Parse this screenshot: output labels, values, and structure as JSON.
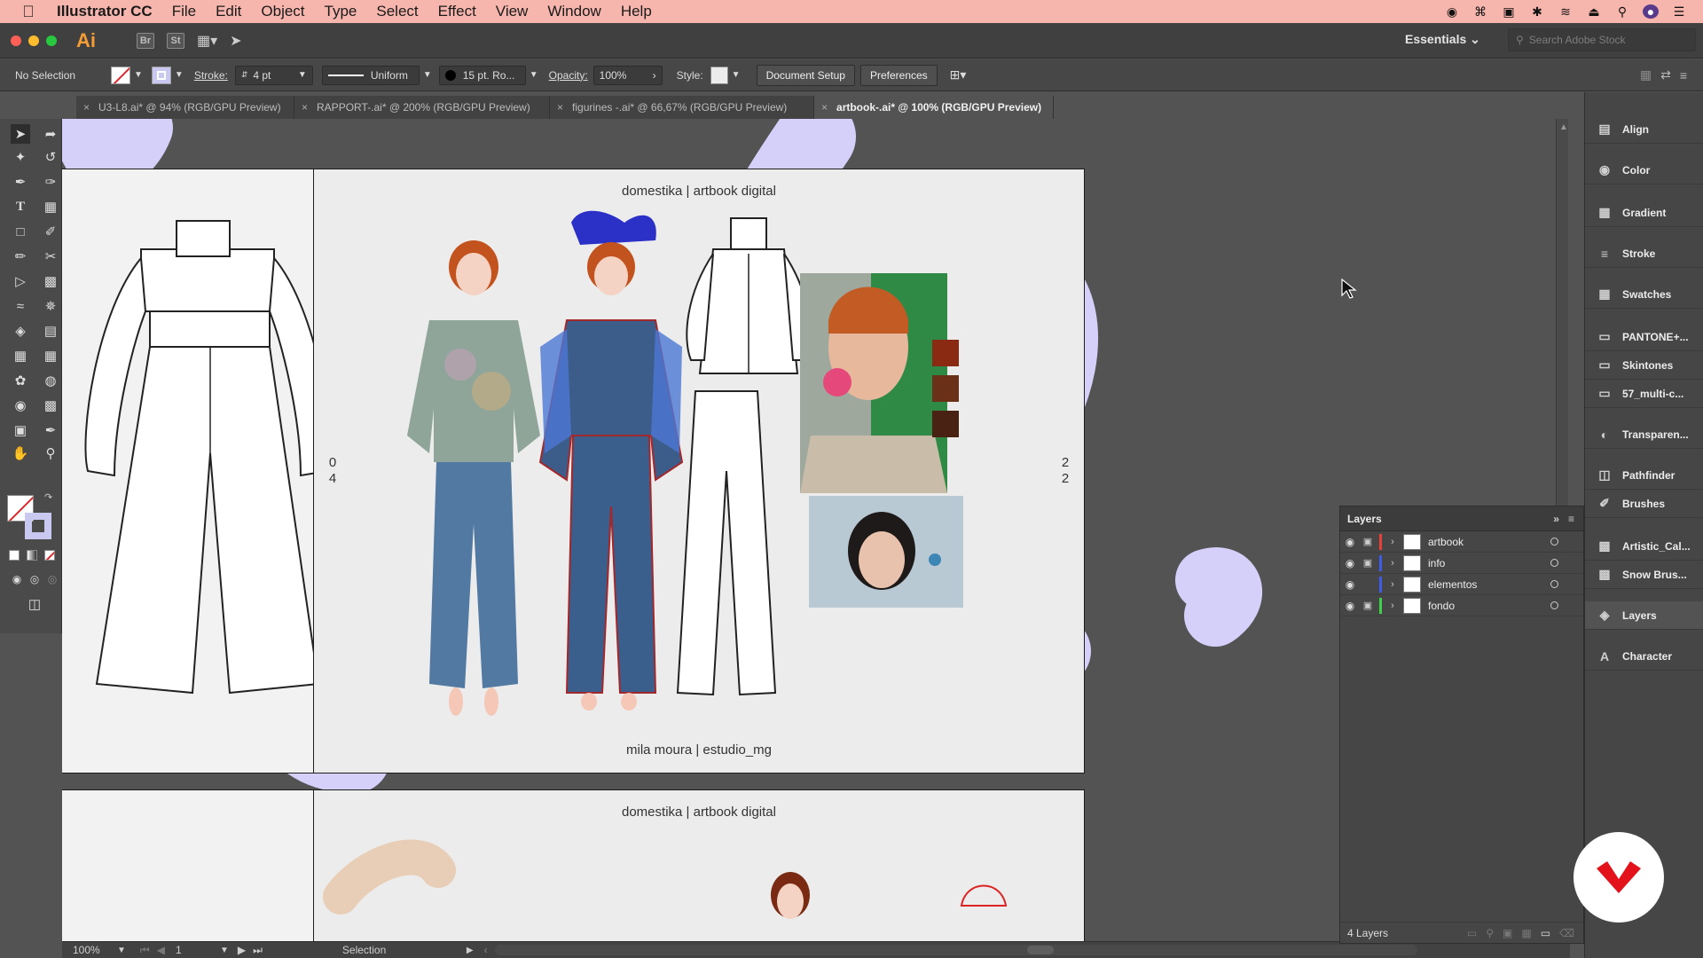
{
  "menubar": {
    "app_name": "Illustrator CC",
    "items": [
      "File",
      "Edit",
      "Object",
      "Type",
      "Select",
      "Effect",
      "View",
      "Window",
      "Help"
    ]
  },
  "appbar": {
    "logo": "Ai",
    "bridge": "Br",
    "stock": "St",
    "workspace": "Essentials",
    "search_placeholder": "Search Adobe Stock"
  },
  "control": {
    "selection": "No Selection",
    "stroke_label": "Stroke:",
    "stroke_weight": "4 pt",
    "profile": "Uniform",
    "brush": "15 pt. Ro...",
    "opacity_label": "Opacity:",
    "opacity": "100%",
    "style_label": "Style:",
    "doc_setup": "Document Setup",
    "preferences": "Preferences"
  },
  "tabs": [
    {
      "label": "U3-L8.ai* @ 94% (RGB/GPU Preview)",
      "active": false
    },
    {
      "label": "RAPPORT-.ai* @ 200% (RGB/GPU Preview)",
      "active": false
    },
    {
      "label": "figurines -.ai* @ 66,67% (RGB/GPU Preview)",
      "active": false
    },
    {
      "label": "artbook-.ai* @ 100% (RGB/GPU Preview)",
      "active": true
    }
  ],
  "artboard": {
    "header": "domestika | artbook digital",
    "footer": "mila moura | estudio_mg",
    "header2": "domestika | artbook digital",
    "left_page_num": [
      "2",
      "2"
    ],
    "mid_page_num": [
      "0",
      "4"
    ],
    "right_page_num": [
      "2",
      "2"
    ]
  },
  "palette_colors": [
    "#8a2a12",
    "#6a3118",
    "#4a2214"
  ],
  "accent_lavender": "#d4d0fa",
  "status": {
    "zoom": "100%",
    "page": "1",
    "mode": "Selection"
  },
  "dock": [
    {
      "label": "Align",
      "icon": "align-icon"
    },
    {
      "label": "Color",
      "icon": "color-icon"
    },
    {
      "label": "Gradient",
      "icon": "gradient-icon"
    },
    {
      "label": "Stroke",
      "icon": "stroke-icon"
    },
    {
      "label": "Swatches",
      "icon": "swatches-icon"
    },
    {
      "label": "PANTONE+...",
      "icon": "folder-icon"
    },
    {
      "label": "Skintones",
      "icon": "folder-icon"
    },
    {
      "label": "57_multi-c...",
      "icon": "folder-icon"
    },
    {
      "label": "Transparen...",
      "icon": "transparency-icon"
    },
    {
      "label": "Pathfinder",
      "icon": "pathfinder-icon"
    },
    {
      "label": "Brushes",
      "icon": "brushes-icon"
    },
    {
      "label": "Artistic_Cal...",
      "icon": "brush-library-icon"
    },
    {
      "label": "Snow Brus...",
      "icon": "brush-library-icon"
    },
    {
      "label": "Layers",
      "icon": "layers-icon"
    },
    {
      "label": "Character",
      "icon": "character-icon"
    }
  ],
  "layers": {
    "title": "Layers",
    "rows": [
      {
        "name": "artbook",
        "color": "#e8413c",
        "locked": true
      },
      {
        "name": "info",
        "color": "#3d5ce8",
        "locked": true
      },
      {
        "name": "elementos",
        "color": "#3d5ce8",
        "locked": false
      },
      {
        "name": "fondo",
        "color": "#3fd14a",
        "locked": true
      }
    ],
    "count": "4 Layers"
  }
}
